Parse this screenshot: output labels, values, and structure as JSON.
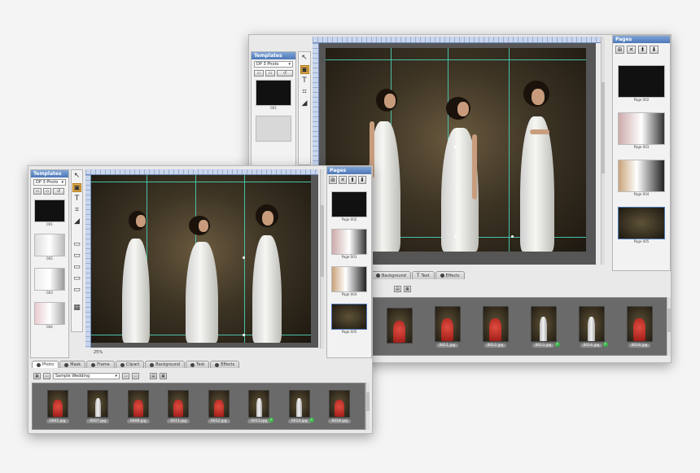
{
  "templates_panel": {
    "title": "Templates",
    "selected": "DP 3 Photo"
  },
  "pages_panel": {
    "title": "Pages",
    "pages_back": [
      "Page 002",
      "Page 003",
      "Page 004",
      "Page 005"
    ],
    "pages_front": [
      "Page 002",
      "Page 003",
      "Page 004",
      "Page 005"
    ]
  },
  "templates_front": [
    "001",
    "002",
    "003",
    "004"
  ],
  "templates_back": [
    "001"
  ],
  "tabs_front": [
    "Photo",
    "Mask",
    "Frame",
    "Clipart",
    "Background",
    "Text",
    "Effects"
  ],
  "tabs_back": [
    "Background",
    "Text",
    "Effects"
  ],
  "zoom_front": "25%",
  "album_select": "Sample Wedding",
  "filmstrip_front": [
    {
      "label": "0001.jpg",
      "kind": "red",
      "check": false
    },
    {
      "label": "0007.jpg",
      "kind": "bride",
      "check": false
    },
    {
      "label": "0008.jpg",
      "kind": "red",
      "check": false
    },
    {
      "label": "0011.jpg",
      "kind": "red",
      "check": false
    },
    {
      "label": "0012.jpg",
      "kind": "red",
      "check": false
    },
    {
      "label": "0013.jpg",
      "kind": "bride",
      "check": true
    },
    {
      "label": "0014.jpg",
      "kind": "bride",
      "check": true
    },
    {
      "label": "0018.jpg",
      "kind": "red",
      "check": false
    }
  ],
  "filmstrip_back": [
    {
      "label": "",
      "kind": "red",
      "check": false
    },
    {
      "label": "0011.jpg",
      "kind": "red",
      "check": false
    },
    {
      "label": "0012.jpg",
      "kind": "red",
      "check": false
    },
    {
      "label": "0013.jpg",
      "kind": "bride",
      "check": true
    },
    {
      "label": "0014.jpg",
      "kind": "bride",
      "check": true
    },
    {
      "label": "0018.jpg",
      "kind": "red",
      "check": false
    }
  ],
  "colors": {
    "accent": "#4d78b6",
    "guide": "#49c1a8",
    "tool_selected": "#f2b64c",
    "check": "#3cb54a"
  }
}
